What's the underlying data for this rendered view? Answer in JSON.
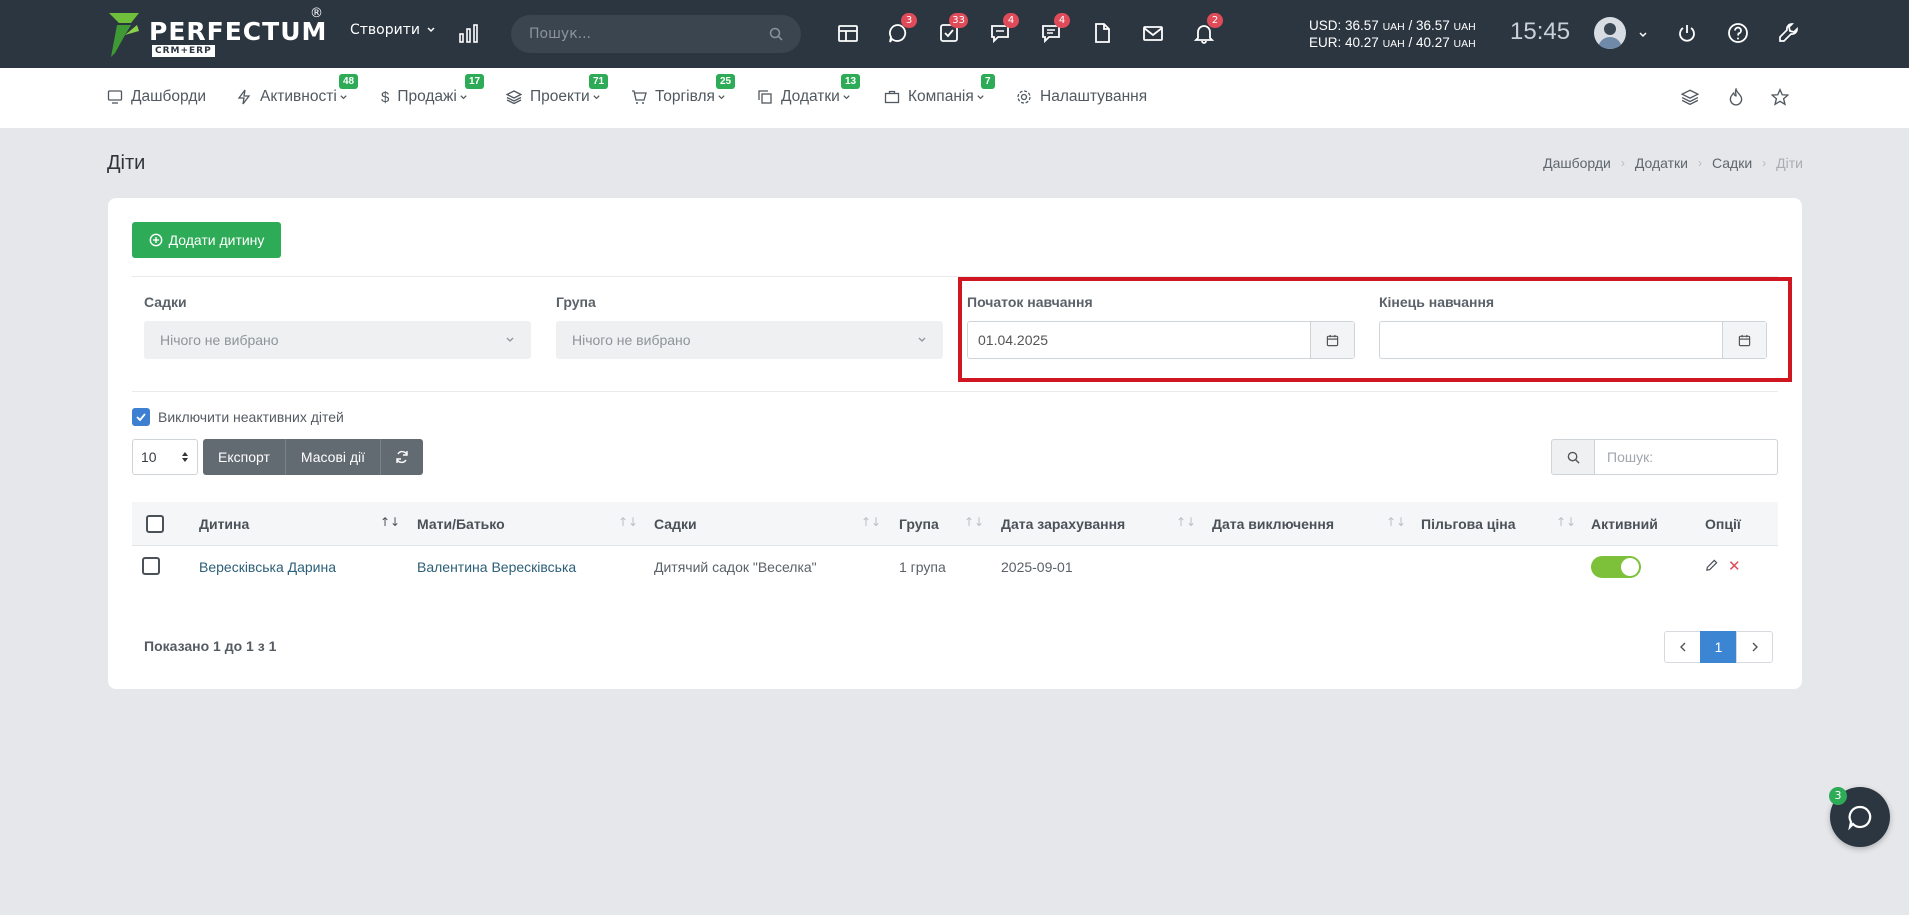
{
  "topbar": {
    "logo_text": "PERFECTUM",
    "logo_sub": "CRM+ERP",
    "logo_reg": "®",
    "create_label": "Створити",
    "search_placeholder": "Пошук...",
    "badges": {
      "chat": "3",
      "tasks": "33",
      "comments": "4",
      "messages": "4",
      "notifications": "2"
    },
    "usd_line": "USD: 36.57",
    "usd_unit1": "UAH",
    "usd_mid": " / 36.57 ",
    "usd_unit2": "UAH",
    "eur_line": "EUR: 40.27",
    "eur_unit1": "UAH",
    "eur_mid": " / 40.27 ",
    "eur_unit2": "UAH",
    "time": "15:45"
  },
  "menu": {
    "items": [
      {
        "label": "Дашборди",
        "badge": ""
      },
      {
        "label": "Активності",
        "badge": "48"
      },
      {
        "label": "Продажі",
        "badge": "17"
      },
      {
        "label": "Проекти",
        "badge": "71"
      },
      {
        "label": "Торгівля",
        "badge": "25"
      },
      {
        "label": "Додатки",
        "badge": "13"
      },
      {
        "label": "Компанія",
        "badge": "7"
      },
      {
        "label": "Налаштування",
        "badge": ""
      }
    ]
  },
  "page": {
    "title": "Діти",
    "breadcrumb": [
      "Дашборди",
      "Додатки",
      "Садки",
      "Діти"
    ]
  },
  "card": {
    "add_button": "Додати дитину",
    "filters": {
      "kindergarten_label": "Садки",
      "kindergarten_value": "Нічого не вибрано",
      "group_label": "Група",
      "group_value": "Нічого не вибрано",
      "start_label": "Початок навчання",
      "start_value": "01.04.2025",
      "end_label": "Кінець навчання",
      "end_value": ""
    },
    "exclude_inactive_label": "Виключити неактивних дітей",
    "per_page": "10",
    "export_label": "Експорт",
    "bulk_label": "Масові дії",
    "search_placeholder": "Пошук:",
    "columns": [
      "Дитина",
      "Мати/Батько",
      "Садки",
      "Група",
      "Дата зарахування",
      "Дата виключення",
      "Пільгова ціна",
      "Активний",
      "Опції"
    ],
    "rows": [
      {
        "child": "Вересківська Дарина",
        "parent": "Валентина Вересківська",
        "kindergarten": "Дитячий садок \"Веселка\"",
        "group": "1 група",
        "enroll_date": "2025-09-01",
        "exclude_date": "",
        "discount": "",
        "active": true
      }
    ],
    "showing": "Показано 1 до 1 з 1",
    "current_page": "1"
  },
  "chat_badge": "3",
  "colors": {
    "topbar": "#2c3641",
    "green": "#2eab56",
    "blue": "#3b85d3",
    "highlight": "#d01620",
    "toggle_on": "#7dc13b"
  }
}
